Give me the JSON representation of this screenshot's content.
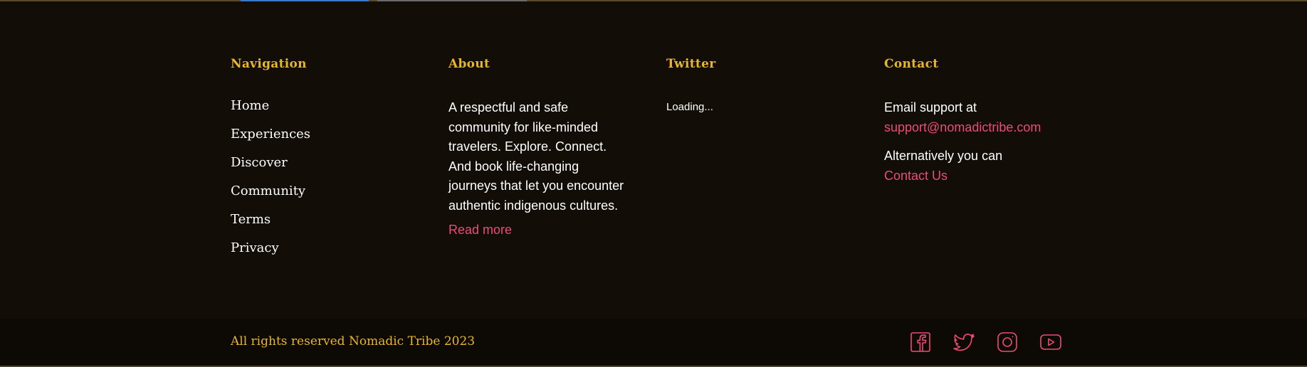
{
  "navigation": {
    "heading": "Navigation",
    "items": [
      {
        "label": "Home"
      },
      {
        "label": "Experiences"
      },
      {
        "label": "Discover"
      },
      {
        "label": "Community"
      },
      {
        "label": "Terms"
      },
      {
        "label": "Privacy"
      }
    ]
  },
  "about": {
    "heading": "About",
    "text": "A respectful and safe community for like-minded travelers. Explore. Connect. And book life-changing journeys that let you encounter authentic indigenous cultures.",
    "read_more_label": "Read more"
  },
  "twitter": {
    "heading": "Twitter",
    "status": "Loading..."
  },
  "contact": {
    "heading": "Contact",
    "email_intro": "Email support at",
    "email": "support@nomadictribe.com",
    "alt_intro": "Alternatively you can",
    "contact_link": "Contact Us"
  },
  "bottom": {
    "copyright": "All rights reserved Nomadic Tribe 2023",
    "socials": [
      {
        "icon": "facebook-icon"
      },
      {
        "icon": "twitter-icon"
      },
      {
        "icon": "instagram-icon"
      },
      {
        "icon": "youtube-icon"
      }
    ]
  },
  "colors": {
    "background": "#120d07",
    "bottom_bar": "#0d0904",
    "heading": "#e7b727",
    "link_accent": "#ec4d76",
    "text": "#ffffff"
  }
}
